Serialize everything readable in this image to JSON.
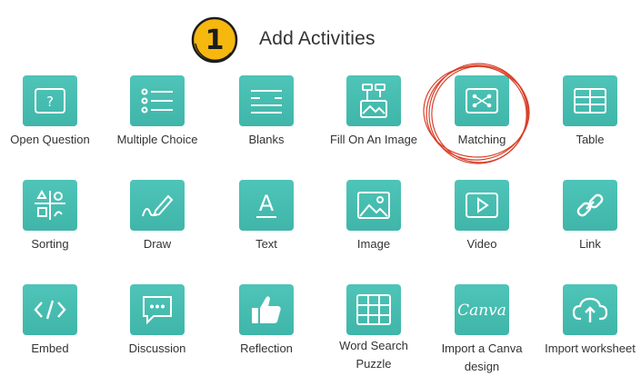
{
  "header": {
    "step_number": "1",
    "title": "Add Activities"
  },
  "colors": {
    "tile": "#45bdb0",
    "badge": "#f6b70f",
    "scribble": "#d9402a"
  },
  "activities": [
    {
      "label": "Open Question",
      "icon": "question-mark-icon"
    },
    {
      "label": "Multiple Choice",
      "icon": "list-icon"
    },
    {
      "label": "Blanks",
      "icon": "blank-lines-icon"
    },
    {
      "label": "Fill On An Image",
      "icon": "image-pin-icon"
    },
    {
      "label": "Matching",
      "icon": "matching-dots-icon"
    },
    {
      "label": "Table",
      "icon": "table-icon"
    },
    {
      "label": "Sorting",
      "icon": "sorting-icon"
    },
    {
      "label": "Draw",
      "icon": "pencil-icon"
    },
    {
      "label": "Text",
      "icon": "text-a-icon"
    },
    {
      "label": "Image",
      "icon": "picture-icon"
    },
    {
      "label": "Video",
      "icon": "play-icon"
    },
    {
      "label": "Link",
      "icon": "chain-link-icon"
    },
    {
      "label": "Embed",
      "icon": "code-icon"
    },
    {
      "label": "Discussion",
      "icon": "chat-bubble-icon"
    },
    {
      "label": "Reflection",
      "icon": "thumbs-up-icon"
    },
    {
      "label": "Word Search",
      "label2": "Puzzle",
      "icon": "grid-icon"
    },
    {
      "label": "Import a Canva",
      "label2": "design",
      "icon": "canva-logo-icon",
      "logo_text": "Canva"
    },
    {
      "label": "Import worksheet",
      "icon": "cloud-upload-icon"
    }
  ]
}
